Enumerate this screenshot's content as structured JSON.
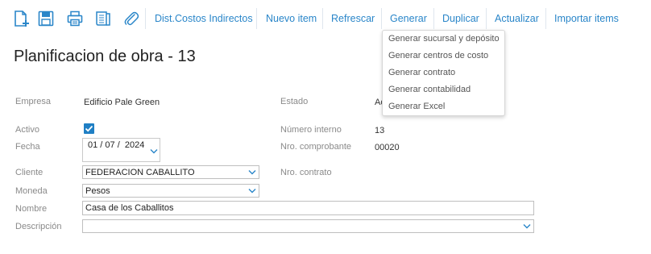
{
  "toolbar": {
    "icons": [
      "new-document-icon",
      "save-icon",
      "print-icon",
      "report-icon",
      "attachment-icon"
    ],
    "buttons": {
      "dist_costos": "Dist.Costos Indirectos",
      "nuevo_item": "Nuevo item",
      "refrescar": "Refrescar",
      "generar": "Generar",
      "duplicar": "Duplicar",
      "actualizar": "Actualizar",
      "importar": "Importar items"
    },
    "accent_color": "#2a86c9"
  },
  "generar_menu": {
    "items": [
      "Generar sucursal y depósito",
      "Generar centros de costo",
      "Generar contrato",
      "Generar contabilidad",
      "Generar Excel"
    ]
  },
  "page": {
    "title": "Planificacion de obra - 13"
  },
  "form": {
    "empresa": {
      "label": "Empresa",
      "value": "Edificio Pale Green"
    },
    "estado": {
      "label": "Estado",
      "value": "Ac"
    },
    "activo": {
      "label": "Activo",
      "checked": true
    },
    "numero_interno": {
      "label": "Número interno",
      "value": "13"
    },
    "fecha": {
      "label": "Fecha",
      "value": "01 / 07 /  2024"
    },
    "nro_comprobante": {
      "label": "Nro. comprobante",
      "value": "00020"
    },
    "cliente": {
      "label": "Cliente",
      "value": "FEDERACION CABALLITO"
    },
    "nro_contrato": {
      "label": "Nro. contrato",
      "value": ""
    },
    "moneda": {
      "label": "Moneda",
      "value": "Pesos"
    },
    "nombre": {
      "label": "Nombre",
      "value": "Casa de los Caballitos"
    },
    "descripcion": {
      "label": "Descripción",
      "value": ""
    }
  }
}
